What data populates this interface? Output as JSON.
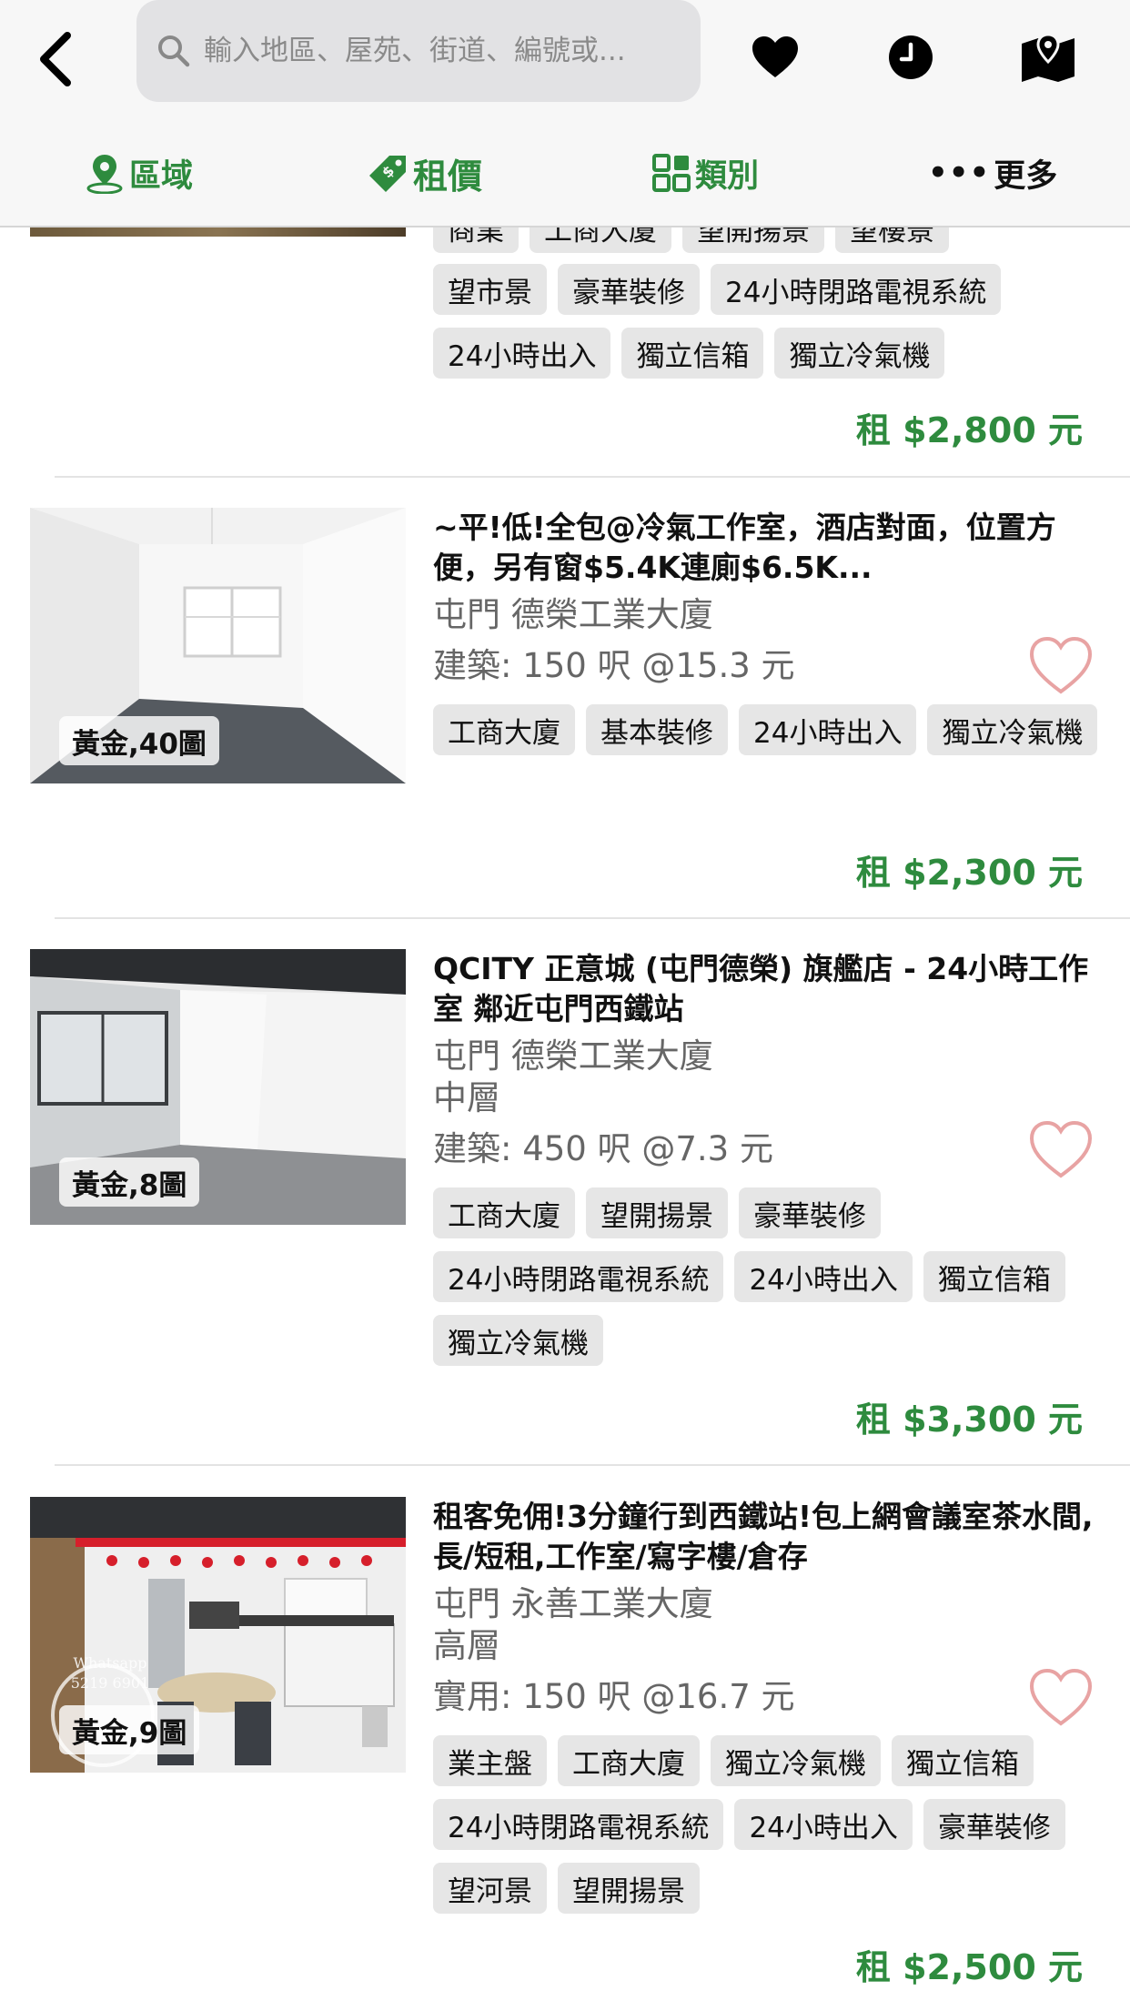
{
  "header": {
    "search_placeholder": "輸入地區、屋苑、街道、編號或...",
    "filters": {
      "area": "區域",
      "price": "租價",
      "category": "類別",
      "more_dots": "•••",
      "more": "更多"
    }
  },
  "partial_listing": {
    "tags_row0": [
      "商業",
      "工商大廈",
      "望開揚景",
      "望樓景"
    ],
    "tags": [
      "望市景",
      "豪華裝修",
      "24小時閉路電視系統",
      "24小時出入",
      "獨立信箱",
      "獨立冷氣機"
    ],
    "price": "租 $2,800 元"
  },
  "listings": [
    {
      "badge": "黃金,40圖",
      "title": "~平!低!全包@冷氣工作室，酒店對面，位置方便，另有窗$5.4K連廁$6.5K...",
      "location": "屯門 德榮工業大廈",
      "floor": "",
      "area": "建築: 150 呎  @15.3 元",
      "tags": [
        "工商大廈",
        "基本裝修",
        "24小時出入",
        "獨立冷氣機"
      ],
      "price": "租 $2,300 元"
    },
    {
      "badge": "黃金,8圖",
      "title": "QCITY 正意城 (屯門德榮) 旗艦店 - 24小時工作室 鄰近屯門西鐵站",
      "location": "屯門 德榮工業大廈",
      "floor": "中層",
      "area": "建築: 450 呎  @7.3 元",
      "tags": [
        "工商大廈",
        "望開揚景",
        "豪華裝修",
        "24小時閉路電視系統",
        "24小時出入",
        "獨立信箱",
        "獨立冷氣機"
      ],
      "price": "租 $3,300 元"
    },
    {
      "badge": "黃金,9圖",
      "watermark": "Whatsapp 5219 6901",
      "title": "租客免佣!3分鐘行到西鐵站!包上網會議室茶水間,長/短租,工作室/寫字樓/倉存",
      "location": "屯門 永善工業大廈",
      "floor": "高層",
      "area": "實用: 150 呎  @16.7 元",
      "tags": [
        "業主盤",
        "工商大廈",
        "獨立冷氣機",
        "獨立信箱",
        "24小時閉路電視系統",
        "24小時出入",
        "豪華裝修",
        "望河景",
        "望開揚景"
      ],
      "price": "租 $2,500 元"
    }
  ],
  "colors": {
    "accent_green": "#2e8b3e",
    "heart_outline": "#e8a3a3",
    "tag_bg": "#e6e6e6"
  },
  "icons": {
    "back": "chevron-left-icon",
    "search": "search-icon",
    "favorites": "heart-icon",
    "history": "clock-icon",
    "map": "map-pin-icon",
    "area_filter": "location-pin-icon",
    "price_filter": "price-tag-icon",
    "category_filter": "grid-icon"
  }
}
